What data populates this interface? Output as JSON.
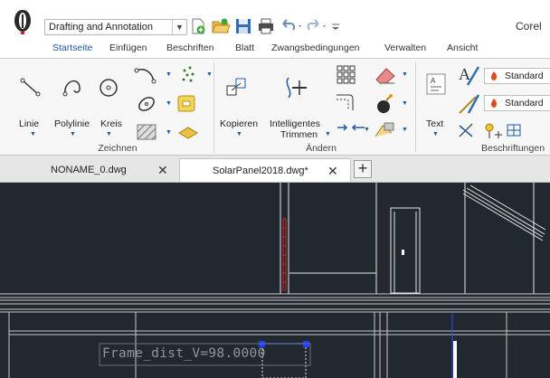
{
  "title_bar": {
    "workspace": "Drafting and Annotation",
    "app_name": "Corel",
    "quick_access_icons": [
      "new-file-icon",
      "open-folder-icon",
      "save-icon",
      "print-icon",
      "undo-icon",
      "redo-icon",
      "customize-icon"
    ]
  },
  "ribbon_tabs": [
    "Startseite",
    "Einfügen",
    "Beschriften",
    "Blatt",
    "Zwangsbedingungen",
    "Verwalten",
    "Ansicht"
  ],
  "active_tab": "Startseite",
  "groups": {
    "draw": {
      "label": "Zeichnen",
      "tools": [
        "Linie",
        "Polylinie",
        "Kreis"
      ]
    },
    "modify": {
      "label": "Ändern",
      "copy": "Kopieren",
      "trim_line1": "Intelligentes",
      "trim_line2": "Trimmen"
    },
    "annotation": {
      "label": "Beschriftungen",
      "text": "Text",
      "style1": "Standard",
      "style2": "Standard"
    }
  },
  "documents": [
    {
      "name": "NONAME_0.dwg",
      "active": false
    },
    {
      "name": "SolarPanel2018.dwg*",
      "active": true
    }
  ],
  "canvas": {
    "background": "#212830",
    "label": "Frame_dist_V=98.0000"
  },
  "colors": {
    "accent": "#1a5aa8",
    "grip": "#1f3cff",
    "highlight_red": "#e02020"
  }
}
